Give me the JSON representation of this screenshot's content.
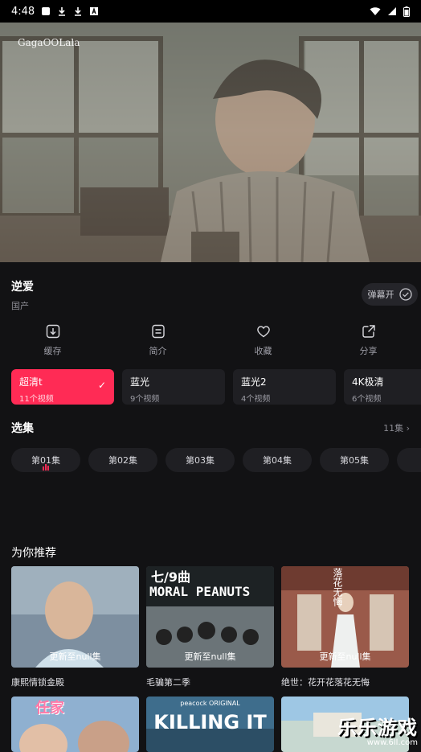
{
  "status": {
    "time": "4:48"
  },
  "video": {
    "logo": "GagaOOLala"
  },
  "show": {
    "title": "逆爱",
    "region": "国产",
    "danmu_label": "弹幕开"
  },
  "actions": [
    {
      "label": "缓存",
      "icon": "download-icon"
    },
    {
      "label": "简介",
      "icon": "info-icon"
    },
    {
      "label": "收藏",
      "icon": "heart-icon"
    },
    {
      "label": "分享",
      "icon": "share-icon"
    }
  ],
  "qualities": [
    {
      "label": "超清t",
      "count": "11个视频",
      "active": true
    },
    {
      "label": "蓝光",
      "count": "9个视频",
      "active": false
    },
    {
      "label": "蓝光2",
      "count": "4个视频",
      "active": false
    },
    {
      "label": "4K极清",
      "count": "6个视频",
      "active": false
    }
  ],
  "episodes": {
    "title": "选集",
    "more": "11集",
    "items": [
      "第01集",
      "第02集",
      "第03集",
      "第04集",
      "第05集",
      ""
    ]
  },
  "recommend": {
    "title": "为你推荐",
    "items": [
      {
        "name": "康熙情锁金殿",
        "caption": "更新至null集"
      },
      {
        "name": "毛骗第二季",
        "caption": "更新至null集",
        "overlay": "MORAL PEANUTS",
        "overlay_top": "七/9曲"
      },
      {
        "name": "绝世：花开花落花无悔",
        "caption": "更新至null集",
        "overlay_top": "落花无悔"
      }
    ],
    "second_row": [
      {
        "overlay": "任家"
      },
      {
        "overlay": "KILLING IT",
        "overlay_top": "peacock ORIGINAL"
      },
      {
        "overlay": ""
      }
    ]
  },
  "watermark": {
    "title": "乐乐游戏",
    "url": "www.6ll.com"
  }
}
